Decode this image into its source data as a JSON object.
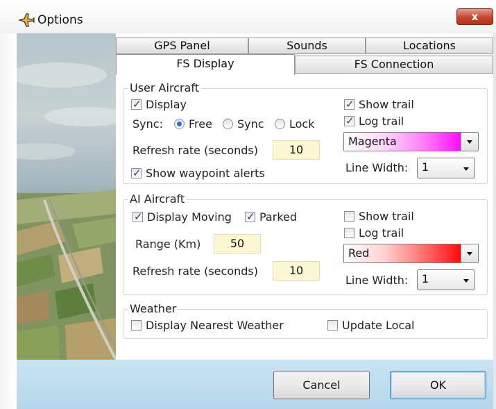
{
  "window": {
    "title": "Options",
    "close_symbol": "x"
  },
  "tabs": {
    "row_top": [
      "GPS Panel",
      "Sounds",
      "Locations"
    ],
    "row_bottom": [
      "FS Display",
      "FS Connection"
    ],
    "active": "FS Display"
  },
  "user_aircraft": {
    "title": "User Aircraft",
    "display": {
      "label": "Display",
      "checked": true
    },
    "sync": {
      "label": "Sync:",
      "options": [
        "Free",
        "Sync",
        "Lock"
      ],
      "selected": "Free"
    },
    "refresh": {
      "label": "Refresh rate (seconds)",
      "value": "10"
    },
    "waypoint_alerts": {
      "label": "Show waypoint alerts",
      "checked": true
    },
    "show_trail": {
      "label": "Show trail",
      "checked": true
    },
    "log_trail": {
      "label": "Log trail",
      "checked": true
    },
    "trail_color": {
      "value": "Magenta",
      "color": "#ff00ff"
    },
    "line_width": {
      "label": "Line Width:",
      "value": "1"
    }
  },
  "ai_aircraft": {
    "title": "AI Aircraft",
    "display_moving": {
      "label": "Display Moving",
      "checked": true
    },
    "parked": {
      "label": "Parked",
      "checked": true
    },
    "range": {
      "label": "Range (Km)",
      "value": "50"
    },
    "refresh": {
      "label": "Refresh rate (seconds)",
      "value": "10"
    },
    "show_trail": {
      "label": "Show trail",
      "checked": false
    },
    "log_trail": {
      "label": "Log trail",
      "checked": false
    },
    "trail_color": {
      "value": "Red",
      "color": "#ff0000"
    },
    "line_width": {
      "label": "Line Width:",
      "value": "1"
    }
  },
  "weather": {
    "title": "Weather",
    "nearest": {
      "label": "Display Nearest Weather",
      "checked": false
    },
    "update_local": {
      "label": "Update Local",
      "checked": false
    }
  },
  "buttons": {
    "cancel": "Cancel",
    "ok": "OK"
  },
  "icons": {
    "title": "airplane-icon",
    "close": "close-icon",
    "dropdown": "chevron-down-icon"
  },
  "colors": {
    "accent": "#2a6fd1",
    "input_bg": "#fdf8d3",
    "footer": "#c1dff0",
    "close": "#c8452d"
  }
}
